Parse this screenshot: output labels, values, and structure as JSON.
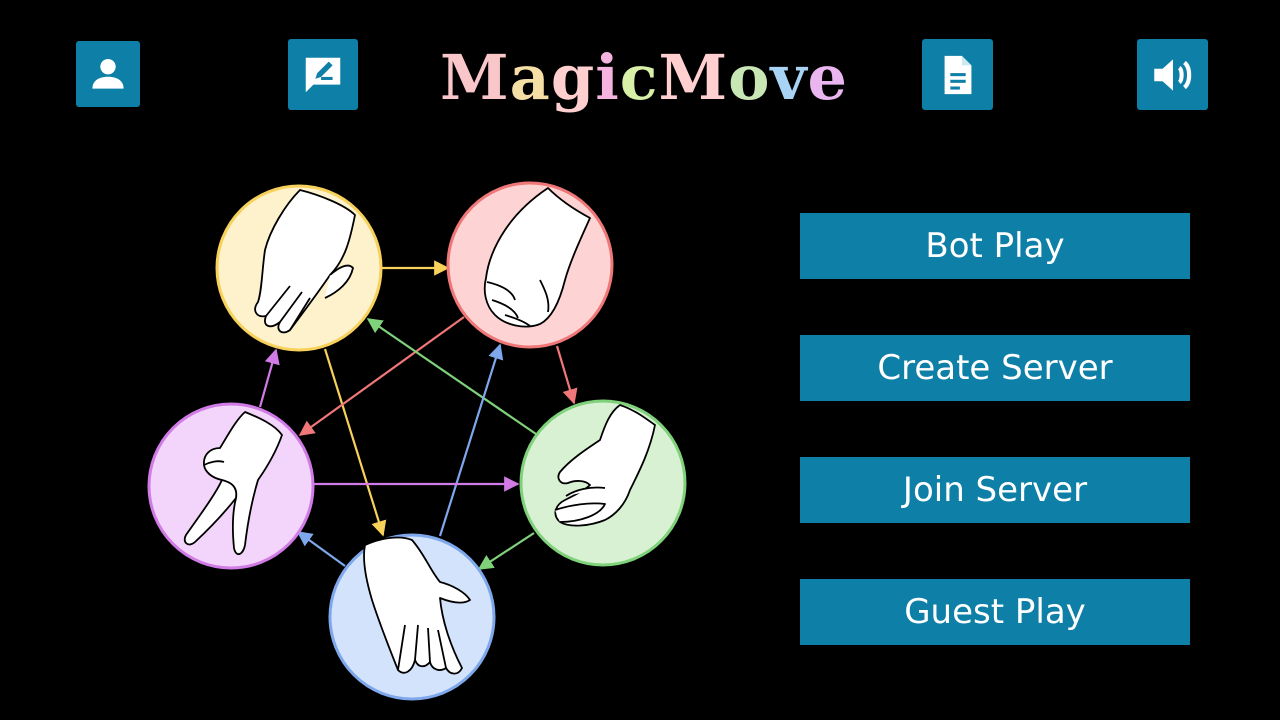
{
  "header": {
    "title_letters": [
      "M",
      "a",
      "g",
      "i",
      "c",
      "M",
      "o",
      "v",
      "e"
    ],
    "title_colors": [
      "#f9c6c9",
      "#f6dfa4",
      "#ffcfcf",
      "#f5b3e0",
      "#c9e6b5",
      "#ffd0cf",
      "#f6b6c0",
      "#a8d3f5",
      "#e9b6f0"
    ],
    "icons": [
      {
        "name": "profile-icon"
      },
      {
        "name": "feedback-icon"
      },
      {
        "name": "rules-icon"
      },
      {
        "name": "sound-icon"
      }
    ]
  },
  "menu": {
    "buttons": [
      {
        "label": "Bot Play"
      },
      {
        "label": "Create Server"
      },
      {
        "label": "Join Server"
      },
      {
        "label": "Guest Play"
      }
    ]
  },
  "moves": [
    {
      "name": "paper",
      "fill": "#fdf2cc",
      "stroke": "#f7d15a"
    },
    {
      "name": "rock",
      "fill": "#fdd3d3",
      "stroke": "#ef7777"
    },
    {
      "name": "pinch",
      "fill": "#d7f1d2",
      "stroke": "#7fd17a"
    },
    {
      "name": "open-hand",
      "fill": "#d3e3fb",
      "stroke": "#7fa8ec"
    },
    {
      "name": "scissors",
      "fill": "#f3d5fb",
      "stroke": "#d17be6"
    }
  ],
  "colors": {
    "button": "#0e7fa6",
    "background": "#000000"
  }
}
